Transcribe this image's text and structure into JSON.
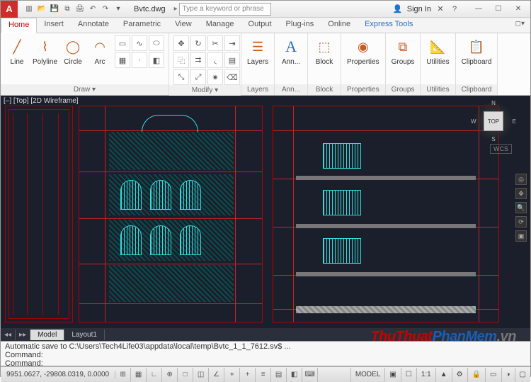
{
  "title": "Bvtc.dwg",
  "search_placeholder": "Type a keyword or phrase",
  "sign_in": "Sign In",
  "ribbon_tabs": [
    "Home",
    "Insert",
    "Annotate",
    "Parametric",
    "View",
    "Manage",
    "Output",
    "Plug-ins",
    "Online",
    "Express Tools"
  ],
  "ribbon_panels": {
    "draw": {
      "label": "Draw ▾",
      "line": "Line",
      "polyline": "Polyline",
      "circle": "Circle",
      "arc": "Arc"
    },
    "modify": {
      "label": "Modify ▾"
    },
    "layers": {
      "label": "Layers",
      "btn": "Layers"
    },
    "annotation": {
      "label": "Ann...",
      "btn": "Ann..."
    },
    "block": {
      "label": "Block",
      "btn": "Block"
    },
    "properties": {
      "label": "Properties",
      "btn": "Properties"
    },
    "groups": {
      "label": "Groups",
      "btn": "Groups"
    },
    "utilities": {
      "label": "Utilities",
      "btn": "Utilities"
    },
    "clipboard": {
      "label": "Clipboard",
      "btn": "Clipboard"
    }
  },
  "view_label": "[–] [Top] [2D Wireframe]",
  "viewcube": {
    "face": "TOP",
    "n": "N",
    "s": "S",
    "e": "E",
    "w": "W"
  },
  "wcs": "WCS",
  "model_tabs": {
    "model": "Model",
    "layout1": "Layout1"
  },
  "command": {
    "line1": "Automatic save to C:\\Users\\Tech4Life03\\appdata\\local\\temp\\Bvtc_1_1_7612.sv$ ...",
    "line2": "Command:",
    "line3": "Command:"
  },
  "status": {
    "coords": "9951.0627, -29808.0319, 0.0000",
    "model": "MODEL",
    "scale": "1:1",
    "anno": "▲"
  },
  "watermark": {
    "a": "ThuThuat",
    "b": "PhanMem",
    "c": ".vn"
  }
}
